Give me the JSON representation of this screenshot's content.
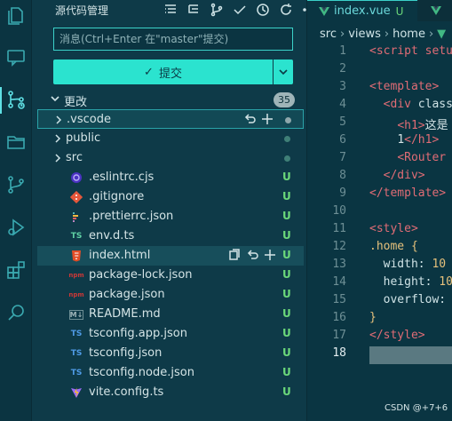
{
  "sidebar": {
    "title": "源代码管理",
    "message_placeholder": "消息(Ctrl+Enter 在\"master\"提交)",
    "commit_label": "提交",
    "changes_label": "更改",
    "changes_count": "35",
    "items": [
      {
        "name": ".vscode",
        "type": "folder",
        "status": ""
      },
      {
        "name": "public",
        "type": "folder",
        "status": ""
      },
      {
        "name": "src",
        "type": "folder",
        "status": ""
      },
      {
        "name": ".eslintrc.cjs",
        "type": "eslint",
        "status": "U"
      },
      {
        "name": ".gitignore",
        "type": "git",
        "status": "U"
      },
      {
        "name": ".prettierrc.json",
        "type": "prettier",
        "status": "U"
      },
      {
        "name": "env.d.ts",
        "type": "ts",
        "status": "U"
      },
      {
        "name": "index.html",
        "type": "html",
        "status": "U"
      },
      {
        "name": "package-lock.json",
        "type": "npm",
        "status": "U"
      },
      {
        "name": "package.json",
        "type": "npm",
        "status": "U"
      },
      {
        "name": "README.md",
        "type": "md",
        "status": "U"
      },
      {
        "name": "tsconfig.app.json",
        "type": "tsconfig",
        "status": "U"
      },
      {
        "name": "tsconfig.json",
        "type": "tsconfig",
        "status": "U"
      },
      {
        "name": "tsconfig.node.json",
        "type": "tsconfig",
        "status": "U"
      },
      {
        "name": "vite.config.ts",
        "type": "vite",
        "status": "U"
      }
    ],
    "icon_ts": "TS",
    "icon_md": "M↓",
    "icon_npm": "npm"
  },
  "editor": {
    "tab_active": "index.vue",
    "tab_active_status": "U",
    "breadcrumb": [
      "src",
      "views",
      "home"
    ],
    "line_numbers": [
      "1",
      "2",
      "3",
      "4",
      "5",
      "6",
      "7",
      "8",
      "9",
      "10",
      "11",
      "12",
      "13",
      "14",
      "15",
      "16",
      "17",
      "18"
    ],
    "lines": {
      "l1": "<script setu",
      "l3": "<template>",
      "l4_tag": "<div",
      "l4_rest": " class",
      "l5_tag": "<h1>",
      "l5_text": "这是",
      "l6_text": "1",
      "l6_tag": "</h1>",
      "l7": "<Router",
      "l8": "</div>",
      "l9": "</template>",
      "l11": "<style>",
      "l12": ".home {",
      "l13_prop": "width:",
      "l13_val": " 10",
      "l14_prop": "height:",
      "l14_val": " 10",
      "l15_prop": "overflow:",
      "l16": "}",
      "l17": "</style>"
    }
  },
  "watermark": "CSDN @+7+6",
  "colors": {
    "accent": "#2be3cf",
    "background": "#0e3a48",
    "untracked": "#6bd87a",
    "tag": "#e06c75"
  }
}
